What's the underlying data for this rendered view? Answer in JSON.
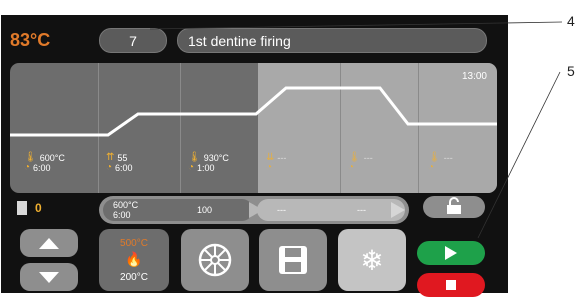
{
  "header": {
    "temperature": "83°C",
    "program_number": "7",
    "program_name": "1st dentine firing"
  },
  "graph": {
    "end_time": "13:00",
    "steps": [
      {
        "line1": "600°C",
        "line2": "6:00"
      },
      {
        "line1": "55",
        "line2": "6:00"
      },
      {
        "line1": "930°C",
        "line2": "1:00"
      },
      {
        "line1": "---",
        "line2": ""
      },
      {
        "line1": "---",
        "line2": ""
      },
      {
        "line1": "---",
        "line2": ""
      }
    ]
  },
  "side": {
    "value": "0"
  },
  "pre_bar": {
    "temp": "600°C",
    "time": "6:00",
    "value": "100",
    "dash1": "---",
    "dash2": "---"
  },
  "vacuum_button": {
    "top_temp": "500°C",
    "bottom_temp": "200°C"
  },
  "callouts": {
    "label_4": "4",
    "label_5": "5"
  },
  "colors": {
    "accent_orange": "#e07a2a",
    "start_green": "#1ea14a",
    "stop_red": "#e01820"
  }
}
